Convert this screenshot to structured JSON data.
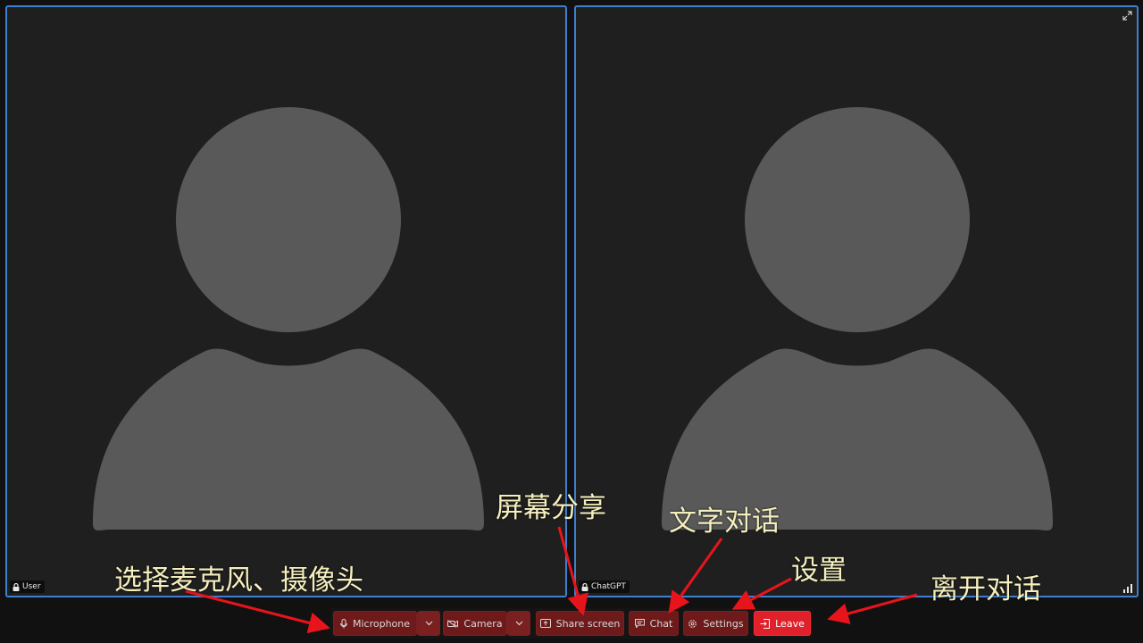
{
  "tiles": {
    "left": {
      "participant_name": "User"
    },
    "right": {
      "participant_name": "ChatGPT"
    }
  },
  "controls": {
    "microphone_label": "Microphone",
    "camera_label": "Camera",
    "share_label": "Share screen",
    "chat_label": "Chat",
    "settings_label": "Settings",
    "leave_label": "Leave"
  },
  "annotations": {
    "devices": "选择麦克风、摄像头",
    "share": "屏幕分享",
    "chat": "文字对话",
    "settings": "设置",
    "leave": "离开对话"
  },
  "colors": {
    "tile_border": "#3f7fd0",
    "control_bg": "#6e1a1a",
    "leave_bg": "#e0202a",
    "annotation_text": "#f5efbe",
    "arrow": "#e8141c"
  }
}
